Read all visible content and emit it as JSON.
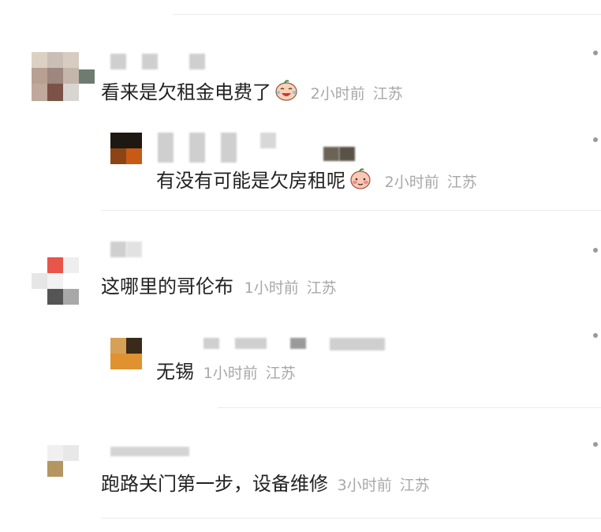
{
  "comments": [
    {
      "text": "看来是欠租金电费了",
      "emoji": "crying-laugh-emoji",
      "time": "2小时前",
      "location": "江苏",
      "replies": [
        {
          "text": "有没有可能是欠房租呢",
          "emoji": "shy-face-emoji",
          "time": "2小时前",
          "location": "江苏"
        }
      ]
    },
    {
      "text": "这哪里的哥伦布",
      "time": "1小时前",
      "location": "江苏",
      "replies": [
        {
          "text": "无锡",
          "time": "1小时前",
          "location": "江苏"
        }
      ]
    },
    {
      "text": "跑路关门第一步，设备维修",
      "time": "3小时前",
      "location": "江苏",
      "replies": []
    }
  ],
  "icons": {
    "more": "more-dots-icon",
    "avatar": "blurred-avatar"
  }
}
